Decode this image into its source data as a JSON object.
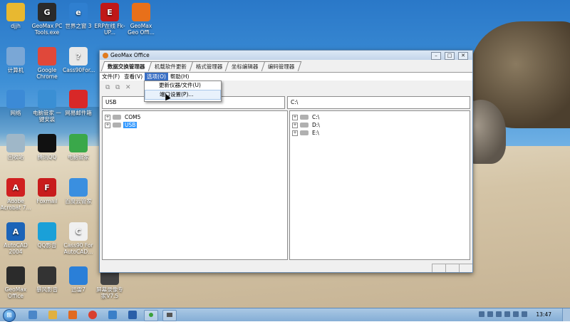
{
  "desktop": {
    "icons": [
      {
        "label": "djjh",
        "color": "#e8b830",
        "glyph": ""
      },
      {
        "label": "GeoMax PC Tools.exe",
        "color": "#2b2b2b",
        "glyph": "G"
      },
      {
        "label": "世界之窗 3",
        "color": "#2f7fd0",
        "glyph": "e"
      },
      {
        "label": "ERP在线 Fk-UP...",
        "color": "#c01818",
        "glyph": "E"
      },
      {
        "label": "GeoMax Geo Offi...",
        "color": "#e8701a",
        "glyph": ""
      },
      {
        "label": "计算机",
        "color": "#7aa7d6",
        "glyph": ""
      },
      {
        "label": "Google Chrome",
        "color": "#e0483a",
        "glyph": ""
      },
      {
        "label": "Cass90For...",
        "color": "#e8e8e8",
        "glyph": "?"
      },
      {
        "label": "网络",
        "color": "#3c8ad6",
        "glyph": ""
      },
      {
        "label": "电脑管家 一键安装",
        "color": "#3a8fd4",
        "glyph": ""
      },
      {
        "label": "网易邮件箱",
        "color": "#d82828",
        "glyph": ""
      },
      {
        "label": "回收站",
        "color": "#9fb7c8",
        "glyph": ""
      },
      {
        "label": "腾讯QQ",
        "color": "#111111",
        "glyph": ""
      },
      {
        "label": "电脑管家",
        "color": "#3aa84a",
        "glyph": ""
      },
      {
        "label": "Adobe Acrobat 7...",
        "color": "#d02020",
        "glyph": "A"
      },
      {
        "label": "Foxmail",
        "color": "#c81c1c",
        "glyph": "F"
      },
      {
        "label": "百度云管家",
        "color": "#3a8fe0",
        "glyph": ""
      },
      {
        "label": "AutoCAD 2004",
        "color": "#1c64b8",
        "glyph": "A"
      },
      {
        "label": "QQ影音",
        "color": "#1aa0d8",
        "glyph": ""
      },
      {
        "label": "Cass90 For AutoCAD...",
        "color": "#f0f0f0",
        "glyph": "C"
      },
      {
        "label": "GeoMax Office",
        "color": "#2b2b2b",
        "glyph": ""
      },
      {
        "label": "暴风影音",
        "color": "#333333",
        "glyph": ""
      },
      {
        "label": "迅雷7",
        "color": "#2a7fd8",
        "glyph": ""
      },
      {
        "label": "屏幕录像专家V7.5",
        "color": "#444444",
        "glyph": ""
      }
    ]
  },
  "window": {
    "title": "GeoMax Office",
    "buttons": {
      "minimize": "–",
      "maximize": "□",
      "close": "✕"
    },
    "tabs": [
      "数据交换管理器",
      "机载软件更新",
      "格式管理器",
      "坐标编辑器",
      "编码管理器"
    ],
    "active_tab": 0,
    "menu": [
      "文件(F)",
      "查看(V)",
      "选项(O)",
      "帮助(H)"
    ],
    "open_menu": 2,
    "dropdown": [
      "更新仪器/文件(U)",
      "端口设置(P)..."
    ],
    "left_path": "USB",
    "right_path": "C:\\",
    "left_tree": [
      {
        "label": "COM5",
        "selected": false
      },
      {
        "label": "USB",
        "selected": true
      }
    ],
    "right_tree": [
      {
        "label": "C:\\"
      },
      {
        "label": "D:\\"
      },
      {
        "label": "E:\\"
      }
    ]
  },
  "taskbar": {
    "start_glyph": "⊞",
    "clock": "13:47"
  }
}
